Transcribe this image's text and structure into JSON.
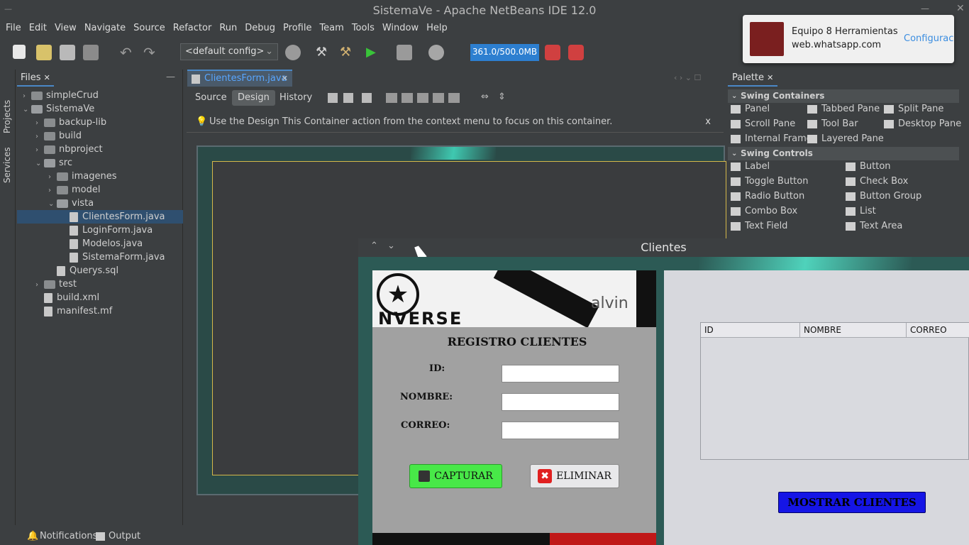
{
  "window_title": "SistemaVe - Apache NetBeans IDE 12.0",
  "menu": [
    "File",
    "Edit",
    "View",
    "Navigate",
    "Source",
    "Refactor",
    "Run",
    "Debug",
    "Profile",
    "Team",
    "Tools",
    "Window",
    "Help"
  ],
  "toolbar": {
    "config": "<default config>",
    "memory": "361.0/500.0MB"
  },
  "left_rail": {
    "projects": "Projects",
    "services": "Services"
  },
  "files_panel": {
    "tab": "Files",
    "tree": [
      {
        "label": "simpleCrud",
        "kind": "folder",
        "depth": 0,
        "expanded": false
      },
      {
        "label": "SistemaVe",
        "kind": "folder",
        "depth": 0,
        "expanded": true
      },
      {
        "label": "backup-lib",
        "kind": "folder",
        "depth": 1,
        "expanded": false
      },
      {
        "label": "build",
        "kind": "folder",
        "depth": 1,
        "expanded": false
      },
      {
        "label": "nbproject",
        "kind": "folder",
        "depth": 1,
        "expanded": false
      },
      {
        "label": "src",
        "kind": "folder",
        "depth": 1,
        "expanded": true
      },
      {
        "label": "imagenes",
        "kind": "folder",
        "depth": 2,
        "expanded": false
      },
      {
        "label": "model",
        "kind": "folder",
        "depth": 2,
        "expanded": false
      },
      {
        "label": "vista",
        "kind": "folder",
        "depth": 2,
        "expanded": true
      },
      {
        "label": "ClientesForm.java",
        "kind": "file",
        "depth": 3,
        "selected": true
      },
      {
        "label": "LoginForm.java",
        "kind": "file",
        "depth": 3
      },
      {
        "label": "Modelos.java",
        "kind": "file",
        "depth": 3
      },
      {
        "label": "SistemaForm.java",
        "kind": "file",
        "depth": 3
      },
      {
        "label": "Querys.sql",
        "kind": "file",
        "depth": 2
      },
      {
        "label": "test",
        "kind": "folder",
        "depth": 1,
        "expanded": false
      },
      {
        "label": "build.xml",
        "kind": "file",
        "depth": 1
      },
      {
        "label": "manifest.mf",
        "kind": "file",
        "depth": 1
      }
    ]
  },
  "editor": {
    "tab": "ClientesForm.java",
    "subtabs": [
      "Source",
      "Design",
      "History"
    ],
    "active_subtab": "Design",
    "hint": "Use the Design This Container action from the context menu to focus on this container.",
    "hint_close": "x"
  },
  "palette": {
    "tab": "Palette",
    "containers_title": "Swing Containers",
    "containers": [
      "Panel",
      "Tabbed Pane",
      "Split Pane",
      "Scroll Pane",
      "Tool Bar",
      "Desktop Pane",
      "Internal Frame",
      "Layered Pane"
    ],
    "controls_title": "Swing Controls",
    "controls": [
      "Label",
      "Button",
      "Toggle Button",
      "Check Box",
      "Radio Button",
      "Button Group",
      "Combo Box",
      "List",
      "Text Field",
      "Text Area"
    ]
  },
  "status": {
    "notifications": "Notifications",
    "output": "Output"
  },
  "notification": {
    "title": "Equipo 8 Herramientas",
    "source": "web.whatsapp.com",
    "action": "Configuración"
  },
  "app_window": {
    "title": "Clientes",
    "heading": "REGISTRO CLIENTES",
    "labels": {
      "id": "ID:",
      "nombre": "NOMBRE:",
      "correo": "CORREO:"
    },
    "fields": {
      "id": "",
      "nombre": "",
      "correo": ""
    },
    "capture_button": "CAPTURAR",
    "delete_button": "ELIMINAR",
    "table_headers": [
      "ID",
      "NOMBRE",
      "CORREO"
    ],
    "show_button": "MOSTRAR CLIENTES",
    "banner_text": [
      "NVERSE",
      "alvin"
    ]
  }
}
